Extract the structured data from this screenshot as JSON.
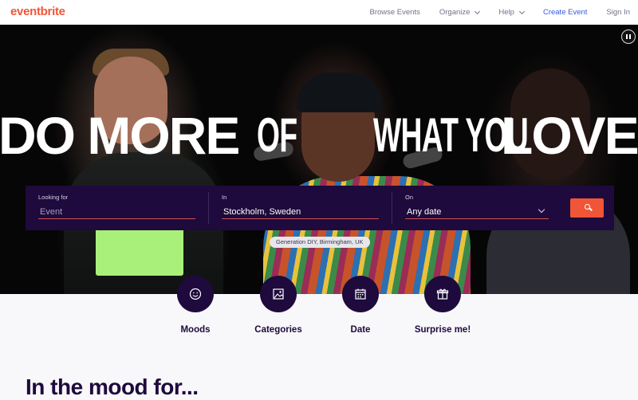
{
  "header": {
    "logo": "eventbrite",
    "nav": {
      "browse": "Browse Events",
      "organize": "Organize",
      "help": "Help",
      "create": "Create Event",
      "signin": "Sign In"
    }
  },
  "hero": {
    "headline": {
      "part1": "DO MORE",
      "part2": "OF",
      "part3": "WHAT YOU",
      "part4": "LOVE"
    },
    "caption": "Generation DIY, Birmingham, UK"
  },
  "search": {
    "looking_for_label": "Looking for",
    "looking_for_placeholder": "Event",
    "in_label": "In",
    "location_value": "Stockholm, Sweden",
    "on_label": "On",
    "date_value": "Any date"
  },
  "categories": [
    {
      "label": "Moods",
      "icon": "smiley-icon"
    },
    {
      "label": "Categories",
      "icon": "image-icon"
    },
    {
      "label": "Date",
      "icon": "calendar-icon"
    },
    {
      "label": "Surprise me!",
      "icon": "gift-icon"
    }
  ],
  "section": {
    "mood_title": "In the mood for..."
  },
  "colors": {
    "brand": "#f05537",
    "navy": "#1e0a3c",
    "link": "#3659e3"
  }
}
